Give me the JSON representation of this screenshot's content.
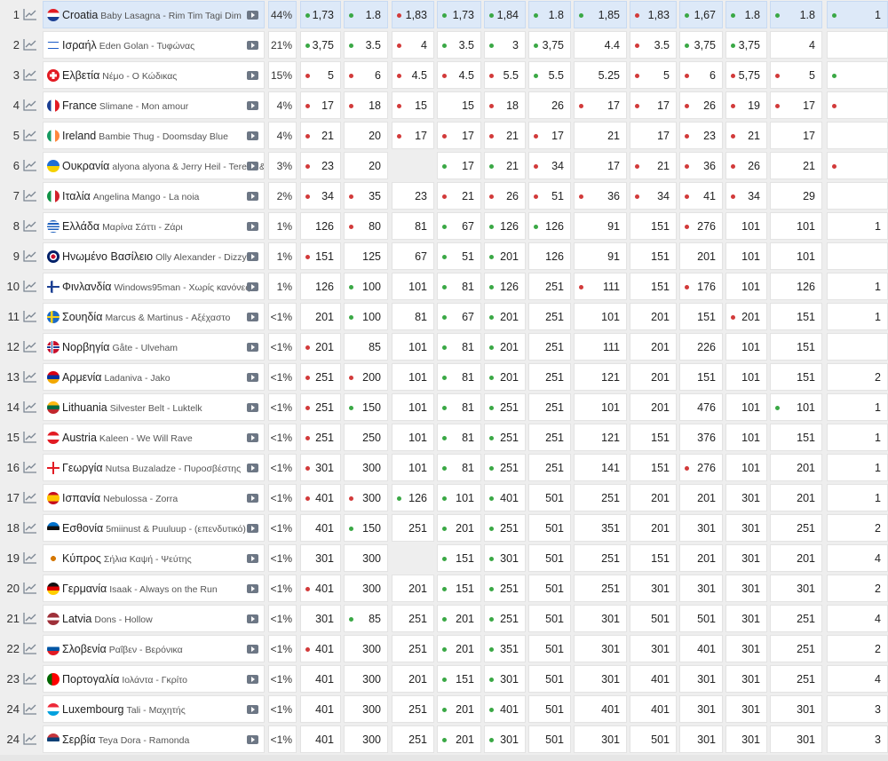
{
  "colors": {
    "green_dot": "#3aa845",
    "red_dot": "#d23a3a",
    "highlight_row": "#dde9f8"
  },
  "rows": [
    {
      "rank": "1",
      "country": "Croatia",
      "song": "Baby Lasagna - Rim Tim Tagi Dim",
      "pct": "44%",
      "flag": "hr",
      "odds": [
        [
          "1,73",
          "g"
        ],
        [
          "1.8",
          "g"
        ],
        [
          "1,83",
          "r"
        ],
        [
          "1,73",
          "g"
        ],
        [
          "1,84",
          "g"
        ],
        [
          "1.8",
          "g"
        ],
        [
          "1,85",
          "g"
        ],
        [
          "1,83",
          "r"
        ],
        [
          "1,67",
          "g"
        ],
        [
          "1.8",
          "g"
        ],
        [
          "1.8",
          "g"
        ],
        [
          "1",
          "g"
        ]
      ]
    },
    {
      "rank": "2",
      "country": "Ισραήλ",
      "song": "Eden Golan - Τυφώνας",
      "pct": "21%",
      "flag": "il",
      "odds": [
        [
          "3,75",
          "g"
        ],
        [
          "3.5",
          "g"
        ],
        [
          "4",
          "r"
        ],
        [
          "3.5",
          "g"
        ],
        [
          "3",
          "g"
        ],
        [
          "3,75",
          "g"
        ],
        [
          "4.4",
          ""
        ],
        [
          "3.5",
          "r"
        ],
        [
          "3,75",
          "g"
        ],
        [
          "3,75",
          "g"
        ],
        [
          "4",
          ""
        ],
        [
          "",
          ""
        ]
      ]
    },
    {
      "rank": "3",
      "country": "Ελβετία",
      "song": "Νέμο - Ο Κώδικας",
      "pct": "15%",
      "flag": "ch",
      "odds": [
        [
          "5",
          "r"
        ],
        [
          "6",
          "r"
        ],
        [
          "4.5",
          "r"
        ],
        [
          "4.5",
          "r"
        ],
        [
          "5.5",
          "r"
        ],
        [
          "5.5",
          "g"
        ],
        [
          "5.25",
          ""
        ],
        [
          "5",
          "r"
        ],
        [
          "6",
          "r"
        ],
        [
          "5,75",
          "r"
        ],
        [
          "5",
          "r"
        ],
        [
          "",
          "g"
        ]
      ]
    },
    {
      "rank": "4",
      "country": "France",
      "song": "Slimane - Mon amour",
      "pct": "4%",
      "flag": "fr",
      "odds": [
        [
          "17",
          "r"
        ],
        [
          "18",
          "r"
        ],
        [
          "15",
          "r"
        ],
        [
          "15",
          ""
        ],
        [
          "18",
          "r"
        ],
        [
          "26",
          ""
        ],
        [
          "17",
          "r"
        ],
        [
          "17",
          "r"
        ],
        [
          "26",
          "r"
        ],
        [
          "19",
          "r"
        ],
        [
          "17",
          "r"
        ],
        [
          "",
          "r"
        ]
      ]
    },
    {
      "rank": "5",
      "country": "Ireland",
      "song": "Bambie Thug - Doomsday Blue",
      "pct": "4%",
      "flag": "ie",
      "odds": [
        [
          "21",
          "r"
        ],
        [
          "20",
          ""
        ],
        [
          "17",
          "r"
        ],
        [
          "17",
          "r"
        ],
        [
          "21",
          "r"
        ],
        [
          "17",
          "r"
        ],
        [
          "21",
          ""
        ],
        [
          "17",
          ""
        ],
        [
          "23",
          "r"
        ],
        [
          "21",
          "r"
        ],
        [
          "17",
          ""
        ],
        [
          "",
          ""
        ]
      ]
    },
    {
      "rank": "6",
      "country": "Ουκρανία",
      "song": "alyona alyona & Jerry Heil - Teresa & Maria",
      "pct": "3%",
      "flag": "ua",
      "odds": [
        [
          "23",
          "r"
        ],
        [
          "20",
          ""
        ],
        [
          "",
          ""
        ],
        [
          "17",
          "g"
        ],
        [
          "21",
          "g"
        ],
        [
          "34",
          "r"
        ],
        [
          "17",
          ""
        ],
        [
          "21",
          "r"
        ],
        [
          "36",
          "r"
        ],
        [
          "26",
          "r"
        ],
        [
          "21",
          ""
        ],
        [
          "",
          "r"
        ]
      ]
    },
    {
      "rank": "7",
      "country": "Ιταλία",
      "song": "Angelina Mango - La noia",
      "pct": "2%",
      "flag": "it",
      "odds": [
        [
          "34",
          "r"
        ],
        [
          "35",
          "r"
        ],
        [
          "23",
          ""
        ],
        [
          "21",
          "r"
        ],
        [
          "26",
          "r"
        ],
        [
          "51",
          "r"
        ],
        [
          "36",
          "r"
        ],
        [
          "34",
          "r"
        ],
        [
          "41",
          "r"
        ],
        [
          "34",
          "r"
        ],
        [
          "29",
          ""
        ],
        [
          "",
          ""
        ]
      ]
    },
    {
      "rank": "8",
      "country": "Ελλάδα",
      "song": "Μαρίνα Σάττι - Ζάρι",
      "pct": "1%",
      "flag": "gr",
      "odds": [
        [
          "126",
          ""
        ],
        [
          "80",
          "r"
        ],
        [
          "81",
          ""
        ],
        [
          "67",
          "g"
        ],
        [
          "126",
          "g"
        ],
        [
          "126",
          "g"
        ],
        [
          "91",
          ""
        ],
        [
          "151",
          ""
        ],
        [
          "276",
          "r"
        ],
        [
          "101",
          ""
        ],
        [
          "101",
          ""
        ],
        [
          "1",
          ""
        ]
      ]
    },
    {
      "rank": "9",
      "country": "Ηνωμένο Βασίλειο",
      "song": "Olly Alexander - Dizzy",
      "pct": "1%",
      "flag": "gb",
      "odds": [
        [
          "151",
          "r"
        ],
        [
          "125",
          ""
        ],
        [
          "67",
          ""
        ],
        [
          "51",
          "g"
        ],
        [
          "201",
          "g"
        ],
        [
          "126",
          ""
        ],
        [
          "91",
          ""
        ],
        [
          "151",
          ""
        ],
        [
          "201",
          ""
        ],
        [
          "101",
          ""
        ],
        [
          "101",
          ""
        ],
        [
          "",
          ""
        ]
      ]
    },
    {
      "rank": "10",
      "country": "Φινλανδία",
      "song": "Windows95man - Χωρίς κανόνες",
      "pct": "1%",
      "flag": "fi",
      "odds": [
        [
          "126",
          ""
        ],
        [
          "100",
          "g"
        ],
        [
          "101",
          ""
        ],
        [
          "81",
          "g"
        ],
        [
          "126",
          "g"
        ],
        [
          "251",
          ""
        ],
        [
          "111",
          "r"
        ],
        [
          "151",
          ""
        ],
        [
          "176",
          "r"
        ],
        [
          "101",
          ""
        ],
        [
          "126",
          ""
        ],
        [
          "1",
          ""
        ]
      ]
    },
    {
      "rank": "11",
      "country": "Σουηδία",
      "song": "Marcus & Martinus - Αξέχαστο",
      "pct": "<1%",
      "flag": "se",
      "odds": [
        [
          "201",
          ""
        ],
        [
          "100",
          "g"
        ],
        [
          "81",
          ""
        ],
        [
          "67",
          "g"
        ],
        [
          "201",
          "g"
        ],
        [
          "251",
          ""
        ],
        [
          "101",
          ""
        ],
        [
          "201",
          ""
        ],
        [
          "151",
          ""
        ],
        [
          "201",
          "r"
        ],
        [
          "151",
          ""
        ],
        [
          "1",
          ""
        ]
      ]
    },
    {
      "rank": "12",
      "country": "Νορβηγία",
      "song": "Gåte - Ulveham",
      "pct": "<1%",
      "flag": "no",
      "odds": [
        [
          "201",
          "r"
        ],
        [
          "85",
          ""
        ],
        [
          "101",
          ""
        ],
        [
          "81",
          "g"
        ],
        [
          "201",
          "g"
        ],
        [
          "251",
          ""
        ],
        [
          "111",
          ""
        ],
        [
          "201",
          ""
        ],
        [
          "226",
          ""
        ],
        [
          "101",
          ""
        ],
        [
          "151",
          ""
        ],
        [
          "",
          ""
        ]
      ]
    },
    {
      "rank": "13",
      "country": "Αρμενία",
      "song": "Ladaniva - Jako",
      "pct": "<1%",
      "flag": "am",
      "odds": [
        [
          "251",
          "r"
        ],
        [
          "200",
          "r"
        ],
        [
          "101",
          ""
        ],
        [
          "81",
          "g"
        ],
        [
          "201",
          "g"
        ],
        [
          "251",
          ""
        ],
        [
          "121",
          ""
        ],
        [
          "201",
          ""
        ],
        [
          "151",
          ""
        ],
        [
          "101",
          ""
        ],
        [
          "151",
          ""
        ],
        [
          "2",
          ""
        ]
      ]
    },
    {
      "rank": "14",
      "country": "Lithuania",
      "song": "Silvester Belt - Luktelk",
      "pct": "<1%",
      "flag": "lt",
      "odds": [
        [
          "251",
          "r"
        ],
        [
          "150",
          "g"
        ],
        [
          "101",
          ""
        ],
        [
          "81",
          "g"
        ],
        [
          "251",
          "g"
        ],
        [
          "251",
          ""
        ],
        [
          "101",
          ""
        ],
        [
          "201",
          ""
        ],
        [
          "476",
          ""
        ],
        [
          "101",
          ""
        ],
        [
          "101",
          "g"
        ],
        [
          "1",
          ""
        ]
      ]
    },
    {
      "rank": "15",
      "country": "Austria",
      "song": "Kaleen - We Will Rave",
      "pct": "<1%",
      "flag": "at",
      "odds": [
        [
          "251",
          "r"
        ],
        [
          "250",
          ""
        ],
        [
          "101",
          ""
        ],
        [
          "81",
          "g"
        ],
        [
          "251",
          "g"
        ],
        [
          "251",
          ""
        ],
        [
          "121",
          ""
        ],
        [
          "151",
          ""
        ],
        [
          "376",
          ""
        ],
        [
          "101",
          ""
        ],
        [
          "151",
          ""
        ],
        [
          "1",
          ""
        ]
      ]
    },
    {
      "rank": "16",
      "country": "Γεωργία",
      "song": "Nutsa Buzaladze - Πυροσβέστης",
      "pct": "<1%",
      "flag": "ge",
      "odds": [
        [
          "301",
          "r"
        ],
        [
          "300",
          ""
        ],
        [
          "101",
          ""
        ],
        [
          "81",
          "g"
        ],
        [
          "251",
          "g"
        ],
        [
          "251",
          ""
        ],
        [
          "141",
          ""
        ],
        [
          "151",
          ""
        ],
        [
          "276",
          "r"
        ],
        [
          "101",
          ""
        ],
        [
          "201",
          ""
        ],
        [
          "1",
          ""
        ]
      ]
    },
    {
      "rank": "17",
      "country": "Ισπανία",
      "song": "Nebulossa - Zorra",
      "pct": "<1%",
      "flag": "es",
      "odds": [
        [
          "401",
          "r"
        ],
        [
          "300",
          "r"
        ],
        [
          "126",
          "g"
        ],
        [
          "101",
          "g"
        ],
        [
          "401",
          "g"
        ],
        [
          "501",
          ""
        ],
        [
          "251",
          ""
        ],
        [
          "201",
          ""
        ],
        [
          "201",
          ""
        ],
        [
          "301",
          ""
        ],
        [
          "201",
          ""
        ],
        [
          "1",
          ""
        ]
      ]
    },
    {
      "rank": "18",
      "country": "Εσθονία",
      "song": "5miinust & Puuluup - (επενδυτικό)",
      "pct": "<1%",
      "flag": "ee",
      "odds": [
        [
          "401",
          ""
        ],
        [
          "150",
          "g"
        ],
        [
          "251",
          ""
        ],
        [
          "201",
          "g"
        ],
        [
          "251",
          "g"
        ],
        [
          "501",
          ""
        ],
        [
          "351",
          ""
        ],
        [
          "201",
          ""
        ],
        [
          "301",
          ""
        ],
        [
          "301",
          ""
        ],
        [
          "251",
          ""
        ],
        [
          "2",
          ""
        ]
      ]
    },
    {
      "rank": "19",
      "country": "Κύπρος",
      "song": "Σήλια Καψή - Ψεύτης",
      "pct": "<1%",
      "flag": "cy",
      "odds": [
        [
          "301",
          ""
        ],
        [
          "300",
          ""
        ],
        [
          "",
          ""
        ],
        [
          "151",
          "g"
        ],
        [
          "301",
          "g"
        ],
        [
          "501",
          ""
        ],
        [
          "251",
          ""
        ],
        [
          "151",
          ""
        ],
        [
          "201",
          ""
        ],
        [
          "301",
          ""
        ],
        [
          "201",
          ""
        ],
        [
          "4",
          ""
        ]
      ]
    },
    {
      "rank": "20",
      "country": "Γερμανία",
      "song": "Isaak - Always on the Run",
      "pct": "<1%",
      "flag": "de",
      "odds": [
        [
          "401",
          "r"
        ],
        [
          "300",
          ""
        ],
        [
          "201",
          ""
        ],
        [
          "151",
          "g"
        ],
        [
          "251",
          "g"
        ],
        [
          "501",
          ""
        ],
        [
          "251",
          ""
        ],
        [
          "301",
          ""
        ],
        [
          "301",
          ""
        ],
        [
          "301",
          ""
        ],
        [
          "301",
          ""
        ],
        [
          "2",
          ""
        ]
      ]
    },
    {
      "rank": "21",
      "country": "Latvia",
      "song": "Dons - Hollow",
      "pct": "<1%",
      "flag": "lv",
      "odds": [
        [
          "301",
          ""
        ],
        [
          "85",
          "g"
        ],
        [
          "251",
          ""
        ],
        [
          "201",
          "g"
        ],
        [
          "251",
          "g"
        ],
        [
          "501",
          ""
        ],
        [
          "301",
          ""
        ],
        [
          "501",
          ""
        ],
        [
          "501",
          ""
        ],
        [
          "301",
          ""
        ],
        [
          "251",
          ""
        ],
        [
          "4",
          ""
        ]
      ]
    },
    {
      "rank": "22",
      "country": "Σλοβενία",
      "song": "Ραΐβεν - Βερόνικα",
      "pct": "<1%",
      "flag": "si",
      "odds": [
        [
          "401",
          "r"
        ],
        [
          "300",
          ""
        ],
        [
          "251",
          ""
        ],
        [
          "201",
          "g"
        ],
        [
          "351",
          "g"
        ],
        [
          "501",
          ""
        ],
        [
          "301",
          ""
        ],
        [
          "301",
          ""
        ],
        [
          "401",
          ""
        ],
        [
          "301",
          ""
        ],
        [
          "251",
          ""
        ],
        [
          "2",
          ""
        ]
      ]
    },
    {
      "rank": "23",
      "country": "Πορτογαλία",
      "song": "Ιολάντα - Γκρίτο",
      "pct": "<1%",
      "flag": "pt",
      "odds": [
        [
          "401",
          ""
        ],
        [
          "300",
          ""
        ],
        [
          "201",
          ""
        ],
        [
          "151",
          "g"
        ],
        [
          "301",
          "g"
        ],
        [
          "501",
          ""
        ],
        [
          "301",
          ""
        ],
        [
          "401",
          ""
        ],
        [
          "301",
          ""
        ],
        [
          "301",
          ""
        ],
        [
          "251",
          ""
        ],
        [
          "4",
          ""
        ]
      ]
    },
    {
      "rank": "24",
      "country": "Luxembourg",
      "song": "Tali - Μαχητής",
      "pct": "<1%",
      "flag": "lu",
      "odds": [
        [
          "401",
          ""
        ],
        [
          "300",
          ""
        ],
        [
          "251",
          ""
        ],
        [
          "201",
          "g"
        ],
        [
          "401",
          "g"
        ],
        [
          "501",
          ""
        ],
        [
          "401",
          ""
        ],
        [
          "401",
          ""
        ],
        [
          "301",
          ""
        ],
        [
          "301",
          ""
        ],
        [
          "301",
          ""
        ],
        [
          "3",
          ""
        ]
      ]
    },
    {
      "rank": "24",
      "country": "Σερβία",
      "song": "Teya Dora - Ramonda",
      "pct": "<1%",
      "flag": "rs",
      "odds": [
        [
          "401",
          ""
        ],
        [
          "300",
          ""
        ],
        [
          "251",
          ""
        ],
        [
          "201",
          "g"
        ],
        [
          "301",
          "g"
        ],
        [
          "501",
          ""
        ],
        [
          "301",
          ""
        ],
        [
          "501",
          ""
        ],
        [
          "301",
          ""
        ],
        [
          "301",
          ""
        ],
        [
          "301",
          ""
        ],
        [
          "3",
          ""
        ]
      ]
    }
  ]
}
